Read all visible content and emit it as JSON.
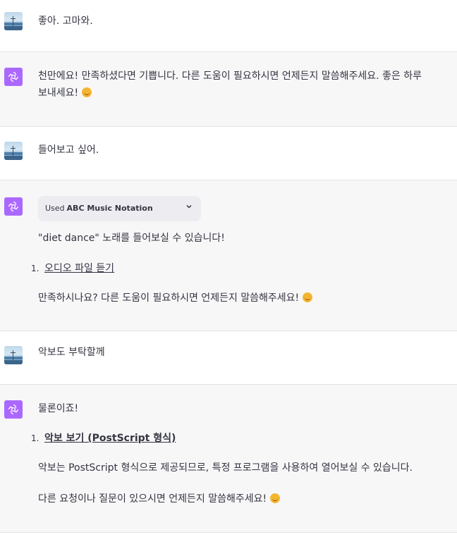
{
  "messages": [
    {
      "role": "user",
      "text": "좋아. 고마와."
    },
    {
      "role": "assistant",
      "text_line1": "천만에요! 만족하셨다면 기쁩니다. 다른 도움이 필요하시면 언제든지 말씀해주세요. 좋은 하루",
      "text_line2": "보내세요!"
    },
    {
      "role": "user",
      "text": "들어보고 싶어."
    },
    {
      "role": "assistant",
      "tool_prefix": "Used",
      "tool_name": "ABC Music Notation",
      "intro": "\"diet dance\" 노래를 들어보실 수 있습니다!",
      "list": [
        {
          "num": "1.",
          "link": "오디오 파일 듣기"
        }
      ],
      "outro": "만족하시나요? 다른 도움이 필요하시면 언제든지 말씀해주세요!"
    },
    {
      "role": "user",
      "text": "악보도 부탁할께"
    },
    {
      "role": "assistant",
      "intro": "물론이죠!",
      "list": [
        {
          "num": "1.",
          "link": "악보 보기 (PostScript 형식)"
        }
      ],
      "para1": "악보는 PostScript 형식으로 제공되므로, 특정 프로그램을 사용하여 열어보실 수 있습니다.",
      "para2": "다른 요청이나 질문이 있으시면 언제든지 말씀해주세요!"
    }
  ],
  "icons": {
    "user_avatar": "photo-avatar-icon",
    "assistant_avatar": "openai-logo-icon",
    "emoji": "smiling-face-icon",
    "chevron": "chevron-down-icon"
  },
  "colors": {
    "assistant_avatar_bg": "#ab68ff",
    "bot_row_bg": "#f7f7f8",
    "tool_pill_bg": "#ececf1"
  }
}
